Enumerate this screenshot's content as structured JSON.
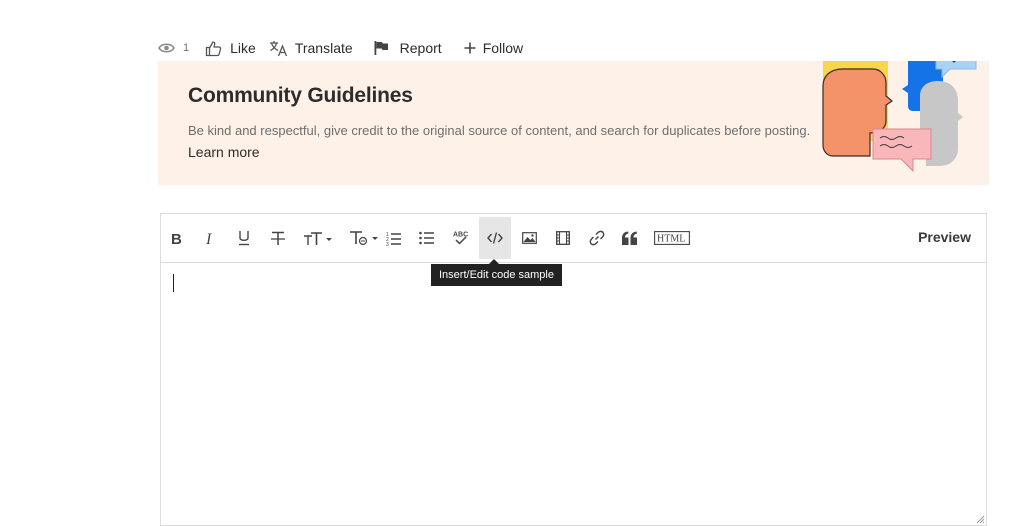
{
  "actions": {
    "view_count": "1",
    "like_label": "Like",
    "translate_label": "Translate",
    "report_label": "Report",
    "follow_label": "Follow"
  },
  "guidelines": {
    "title": "Community Guidelines",
    "text": "Be kind and respectful, give credit to the original source of content, and search for duplicates before posting.",
    "link_label": "Learn more"
  },
  "editor": {
    "toolbar": {
      "buttons": [
        {
          "id": "bold",
          "icon": "bold-icon"
        },
        {
          "id": "italic",
          "icon": "italic-icon"
        },
        {
          "id": "underline",
          "icon": "underline-icon"
        },
        {
          "id": "strikethrough",
          "icon": "strikethrough-icon"
        },
        {
          "id": "font-size",
          "icon": "font-size-icon"
        },
        {
          "id": "text-format",
          "icon": "text-format-icon"
        },
        {
          "id": "numbered-list",
          "icon": "numbered-list-icon"
        },
        {
          "id": "bullet-list",
          "icon": "bullet-list-icon"
        },
        {
          "id": "spellcheck",
          "icon": "spellcheck-icon"
        },
        {
          "id": "code-sample",
          "icon": "code-icon",
          "active": true
        },
        {
          "id": "image",
          "icon": "image-icon"
        },
        {
          "id": "video",
          "icon": "video-icon"
        },
        {
          "id": "link",
          "icon": "link-icon"
        },
        {
          "id": "blockquote",
          "icon": "quote-icon"
        },
        {
          "id": "html",
          "icon": "html-icon",
          "label": "HTML"
        }
      ],
      "preview_label": "Preview"
    },
    "tooltip": "Insert/Edit code sample",
    "content": ""
  },
  "colors": {
    "banner_bg": "#fef2e8",
    "tooltip_bg": "#222222",
    "active_button_bg": "#e6e6e6"
  }
}
